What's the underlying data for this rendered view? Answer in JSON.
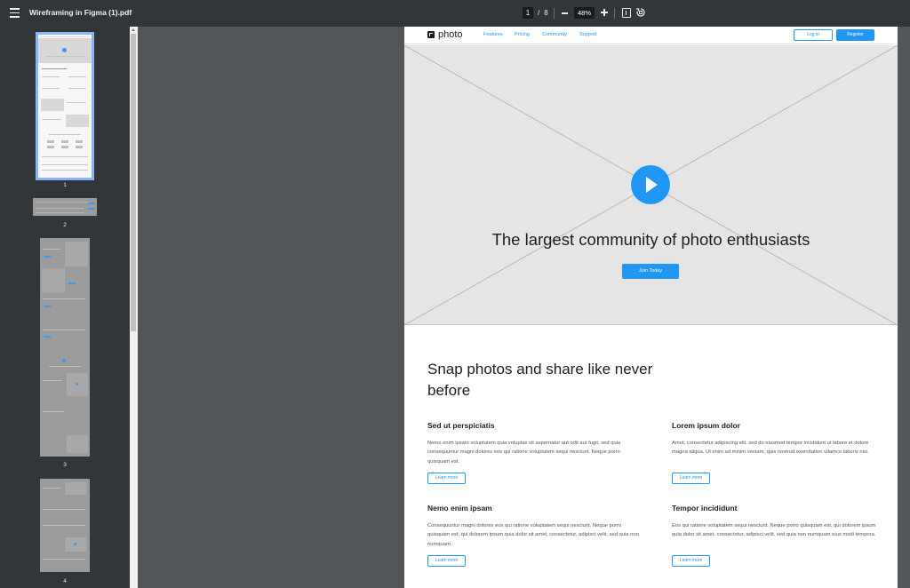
{
  "toolbar": {
    "title": "Wireframing in Figma (1).pdf",
    "page_current": "1",
    "page_total": "8",
    "page_separator": "/",
    "zoom": "48%"
  },
  "sidebar": {
    "thumbnails": [
      {
        "label": "1",
        "selected": true
      },
      {
        "label": "2",
        "selected": false
      },
      {
        "label": "3",
        "selected": false
      },
      {
        "label": "4",
        "selected": false
      }
    ]
  },
  "page": {
    "logo": "photo",
    "nav": [
      "Features",
      "Pricing",
      "Community",
      "Support"
    ],
    "login": "Log in",
    "register": "Register",
    "hero_title": "The largest community of photo enthusiasts",
    "join": "Join Today",
    "section_title": "Snap photos and share like never before",
    "features": [
      {
        "title": "Sed ut perspiciatis",
        "text": "Nemo enim ipsam voluptatem quia voluptas sit aspernatur aut odit aut fugit, sed quia consequuntur magni dolores eos qui ratione voluptatem sequi nesciunt. Neque porro quisquam est.",
        "cta": "Learn more"
      },
      {
        "title": "Lorem ipsum dolor",
        "text": "Amet, consectetur adipiscing elit, sed do eiusmod tempor incididunt ut labore et dolore magna aliqua. Ut enim ad minim veniam, quis nostrud exercitation ullamco laboris nisi.",
        "cta": "Learn more"
      },
      {
        "title": "Nemo enim ipsam",
        "text": "Consequuntur magni dolores eos qui ratione voluptatem sequi nesciunt. Neque porro quisquam est, qui dolorem ipsum quia dolor sit amet, consectetur, adipisci velit, sed quia non numquam.",
        "cta": "Learn more"
      },
      {
        "title": "Tempor incididunt",
        "text": "Eos qui ratione voluptatem sequi nesciunt. Neque porro quisquam est, qui dolorem ipsum quia dolor sit amet, consectetur, adipisci velit, sed quia non numquam eius modi tempora.",
        "cta": "Learn more"
      }
    ]
  },
  "colors": {
    "accent": "#2196f3",
    "toolbar": "#323639",
    "canvas": "#525659",
    "selection": "#8ab4f8"
  },
  "icons": [
    "menu-icon",
    "zoom-out-icon",
    "zoom-in-icon",
    "fit-page-icon",
    "rotate-icon",
    "play-icon"
  ]
}
